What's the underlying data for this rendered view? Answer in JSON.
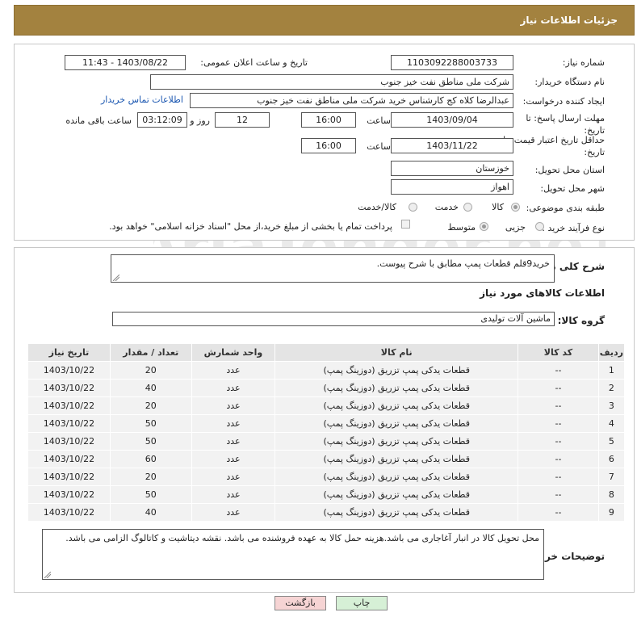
{
  "header": {
    "title": "جزئیات اطلاعات نیاز"
  },
  "form": {
    "need_number_label": "شماره نیاز:",
    "need_number": "1103092288003733",
    "announce_label": "تاریخ و ساعت اعلان عمومی:",
    "announce_value": "1403/08/22 - 11:43",
    "buyer_org_label": "نام دستگاه خریدار:",
    "buyer_org": "شرکت ملی مناطق نفت خیز جنوب",
    "creator_label": "ایجاد کننده درخواست:",
    "creator": "عبدالرضا کلاه کج  کارشناس خرید شرکت ملی مناطق نفت خیز جنوب",
    "contact_link": "اطلاعات تماس خریدار",
    "deadline_label_1": "مهلت ارسال پاسخ: تا",
    "deadline_label_2": "تاریخ:",
    "deadline_date": "1403/09/04",
    "time_label": "ساعت",
    "deadline_time": "16:00",
    "days_value": "12",
    "days_label": "روز و",
    "remaining_value": "03:12:09",
    "remaining_label": "ساعت باقی مانده",
    "validity_label_1": "حداقل تاریخ اعتبار قیمت: تا",
    "validity_label_2": "تاریخ:",
    "validity_date": "1403/11/22",
    "validity_time": "16:00",
    "province_label": "استان محل تحویل:",
    "province": "خوزستان",
    "city_label": "شهر محل تحویل:",
    "city": "اهواز",
    "category_label": "طبقه بندی موضوعی:",
    "category_options": [
      "کالا",
      "خدمت",
      "کالا/خدمت"
    ],
    "purchase_type_label": "نوع فرآیند خرید :",
    "purchase_options": [
      "جزیی",
      "متوسط"
    ],
    "payment_note": "پرداخت تمام یا بخشی از مبلغ خرید،از محل \"اسناد خزانه اسلامی\" خواهد بود."
  },
  "summary": {
    "label": "شرح کلی نیاز:",
    "text": "خرید9قلم قطعات پمپ مطابق با شرح پیوست.",
    "goods_info_title": "اطلاعات کالاهای مورد نیاز",
    "group_label": "گروه کالا:",
    "group_value": "ماشین آلات تولیدی"
  },
  "table": {
    "headers": [
      "ردیف",
      "کد کالا",
      "نام کالا",
      "واحد شمارش",
      "تعداد / مقدار",
      "تاریخ نیاز"
    ],
    "rows": [
      [
        "1",
        "--",
        "قطعات یدکی پمپ تزریق (دوزینگ پمپ)",
        "عدد",
        "20",
        "1403/10/22"
      ],
      [
        "2",
        "--",
        "قطعات یدکی پمپ تزریق (دوزینگ پمپ)",
        "عدد",
        "40",
        "1403/10/22"
      ],
      [
        "3",
        "--",
        "قطعات یدکی پمپ تزریق (دوزینگ پمپ)",
        "عدد",
        "20",
        "1403/10/22"
      ],
      [
        "4",
        "--",
        "قطعات یدکی پمپ تزریق (دوزینگ پمپ)",
        "عدد",
        "50",
        "1403/10/22"
      ],
      [
        "5",
        "--",
        "قطعات یدکی پمپ تزریق (دوزینگ پمپ)",
        "عدد",
        "50",
        "1403/10/22"
      ],
      [
        "6",
        "--",
        "قطعات یدکی پمپ تزریق (دوزینگ پمپ)",
        "عدد",
        "60",
        "1403/10/22"
      ],
      [
        "7",
        "--",
        "قطعات یدکی پمپ تزریق (دوزینگ پمپ)",
        "عدد",
        "20",
        "1403/10/22"
      ],
      [
        "8",
        "--",
        "قطعات یدکی پمپ تزریق (دوزینگ پمپ)",
        "عدد",
        "50",
        "1403/10/22"
      ],
      [
        "9",
        "--",
        "قطعات یدکی پمپ تزریق (دوزینگ پمپ)",
        "عدد",
        "40",
        "1403/10/22"
      ]
    ]
  },
  "notes": {
    "label": "توضیحات خریدار:",
    "text": "محل تحویل کالا در انبار آغاجاری می باشد.هزینه حمل کالا به عهده فروشنده می باشد. نقشه دیتاشیت و کاتالوگ الزامی می باشد."
  },
  "buttons": {
    "print": "چاپ",
    "back": "بازگشت"
  },
  "watermark": {
    "text": "AriaTender.neT"
  },
  "colors": {
    "header": "#a3823f",
    "print_button": "#d6f0d6",
    "back_button": "#f6d4d4",
    "link": "#1a56b0"
  },
  "icons": {
    "resize": "resize-grip-icon"
  }
}
